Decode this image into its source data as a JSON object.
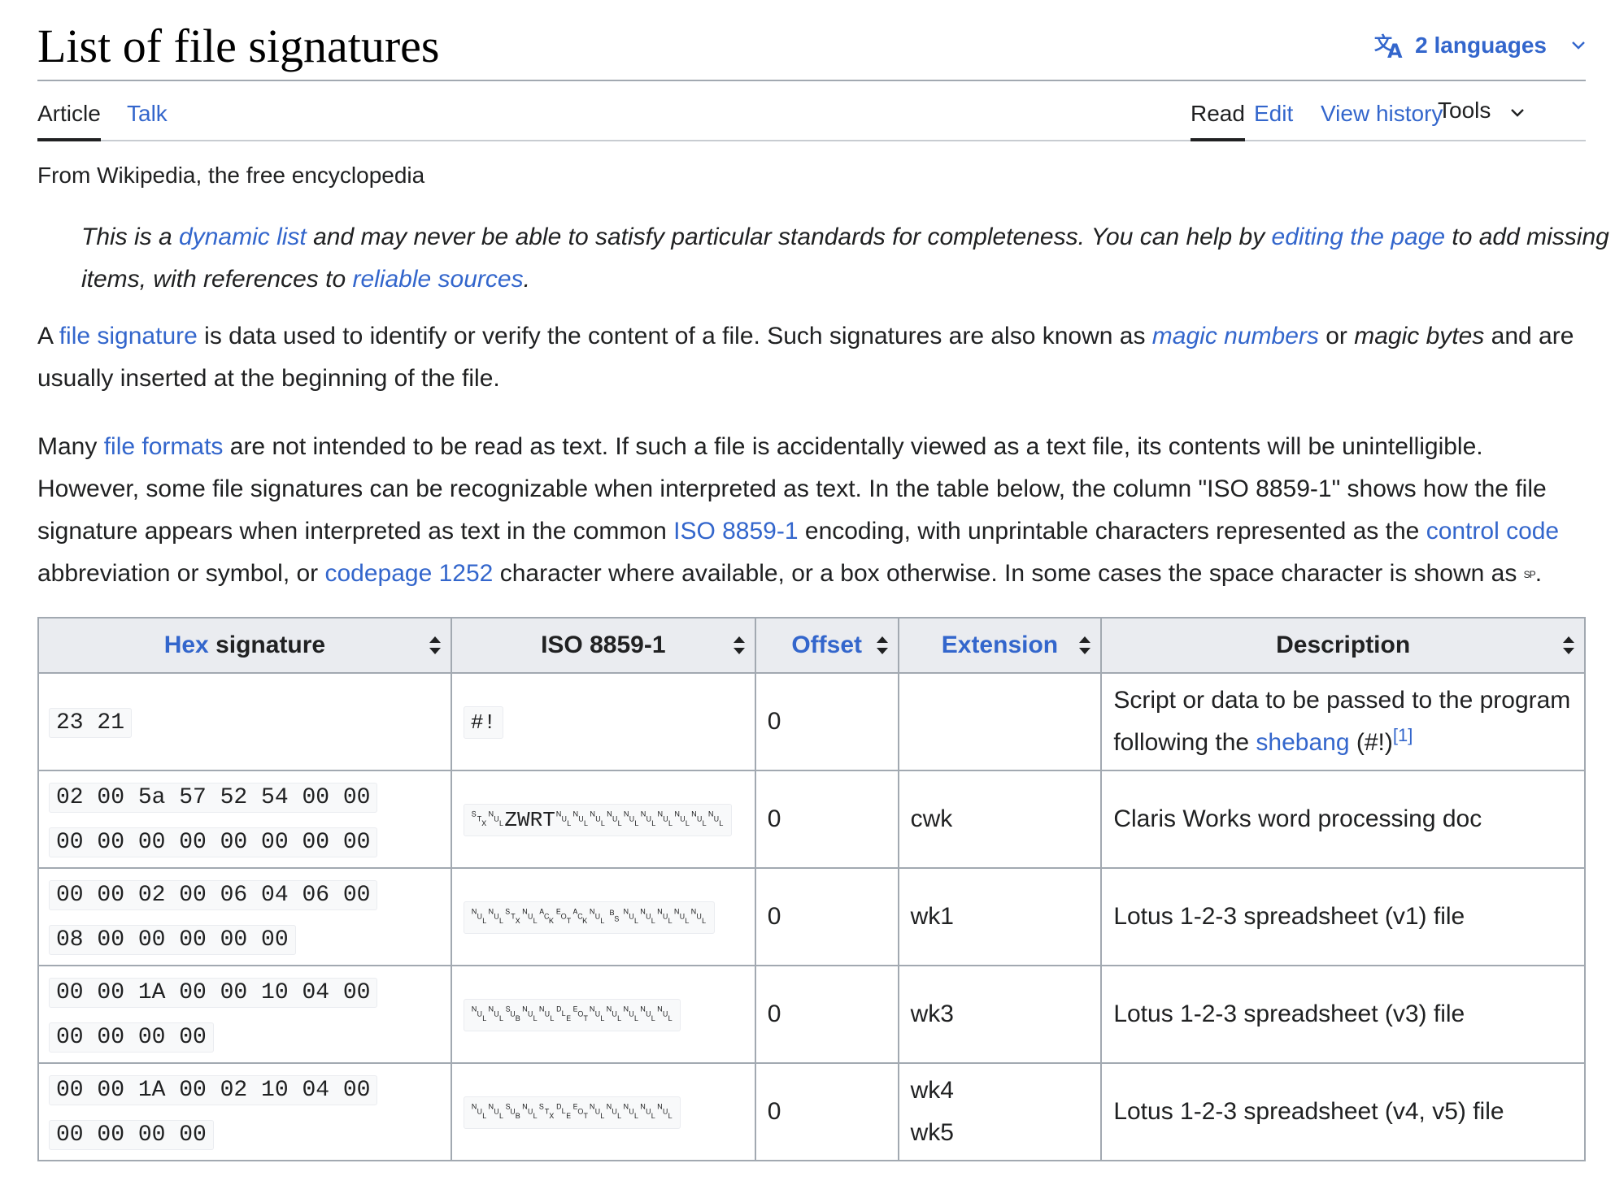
{
  "page": {
    "title": "List of file signatures",
    "languages_label": "2 languages"
  },
  "tabs": {
    "article": "Article",
    "talk": "Talk",
    "read": "Read",
    "edit": "Edit",
    "view_history": "View history",
    "tools": "Tools"
  },
  "tagline": "From Wikipedia, the free encyclopedia",
  "hatnote": {
    "t1": "This is a ",
    "link1": "dynamic list",
    "t2": " and may never be able to satisfy particular standards for completeness. You can help by ",
    "link2": "editing the page",
    "t3": " to add missing items, with references to ",
    "link3": "reliable sources",
    "t4": "."
  },
  "intro": {
    "p1": {
      "t1": "A ",
      "link1": "file signature",
      "t2": " is data used to identify or verify the content of a file. Such signatures are also known as ",
      "link2": "magic numbers",
      "t3": " or ",
      "em1": "magic bytes",
      "t4": " and are usually inserted at the beginning of the file."
    },
    "p2": {
      "t1": "Many ",
      "link1": "file formats",
      "t2": " are not intended to be read as text. If such a file is accidentally viewed as a text file, its contents will be unintelligible. However, some file signatures can be recognizable when interpreted as text. In the table below, the column \"ISO 8859-1\" shows how the file signature appears when interpreted as text in the common ",
      "link2": "ISO 8859-1",
      "t3": " encoding, with unprintable characters represented as the ",
      "link3": "control code",
      "t4": " abbreviation or symbol, or ",
      "link4": "codepage 1252",
      "t5": " character where available, or a box otherwise. In some cases the space character is shown as ",
      "sp": "SP",
      "t6": "."
    }
  },
  "table": {
    "headers": {
      "hex_link": "Hex",
      "hex_rest": " signature",
      "iso": "ISO 8859-1",
      "offset": "Offset",
      "extension": "Extension",
      "description": "Description"
    },
    "rows": [
      {
        "hex": "23 21",
        "iso": "#!",
        "offset": "0",
        "ext": "",
        "ext2": "",
        "desc_t1": "Script or data to be passed to the program following the ",
        "desc_link": "shebang",
        "desc_t2": " (#!)",
        "desc_ref": "[1]"
      },
      {
        "hex": "02 00 5a 57 52 54 00 00 00 00 00 00 00 00 00 00",
        "iso": "␂␀ZWRT␀␀␀␀␀␀␀␀␀␀",
        "offset": "0",
        "ext": "cwk",
        "ext2": "",
        "desc_t1": "Claris Works word processing doc",
        "desc_link": "",
        "desc_t2": "",
        "desc_ref": ""
      },
      {
        "hex": "00 00 02 00 06 04 06 00 08 00 00 00 00 00",
        "iso": "␀␀␂␀␆␄␆␀␈␀␀␀␀␀",
        "offset": "0",
        "ext": "wk1",
        "ext2": "",
        "desc_t1": "Lotus 1-2-3 spreadsheet (v1) file",
        "desc_link": "",
        "desc_t2": "",
        "desc_ref": ""
      },
      {
        "hex": "00 00 1A 00 00 10 04 00 00 00 00 00",
        "iso": "␀␀␚␀␀␐␄␀␀␀␀␀",
        "offset": "0",
        "ext": "wk3",
        "ext2": "",
        "desc_t1": "Lotus 1-2-3 spreadsheet (v3) file",
        "desc_link": "",
        "desc_t2": "",
        "desc_ref": ""
      },
      {
        "hex": "00 00 1A 00 02 10 04 00 00 00 00 00",
        "iso": "␀␀␚␀␂␐␄␀␀␀␀␀",
        "offset": "0",
        "ext": "wk4",
        "ext2": "wk5",
        "desc_t1": "Lotus 1-2-3 spreadsheet (v4, v5) file",
        "desc_link": "",
        "desc_t2": "",
        "desc_ref": ""
      }
    ]
  }
}
